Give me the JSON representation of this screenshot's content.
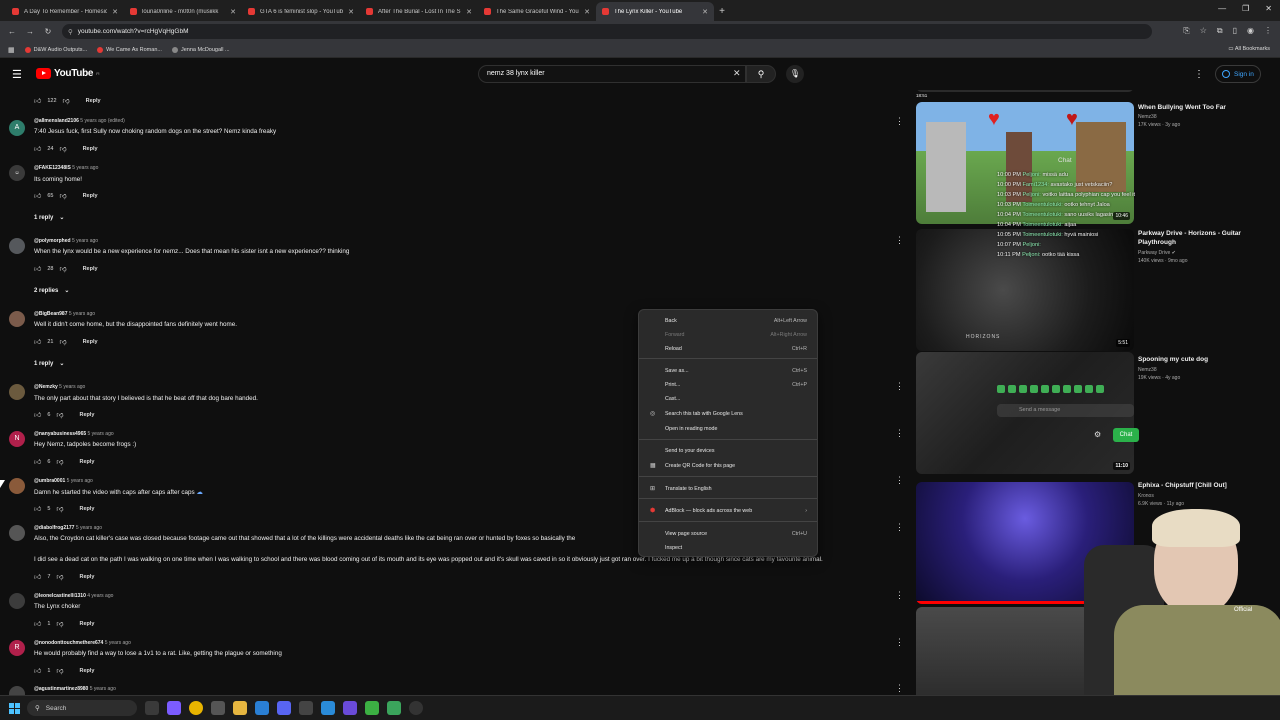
{
  "browser": {
    "tabs": [
      {
        "title": "A Day To Remember - Homesic",
        "active": false
      },
      {
        "title": "louna0nline - m0t0n (musiikk",
        "active": false
      },
      {
        "title": "GTA 6 is feminist slop - YouTub",
        "active": false
      },
      {
        "title": "After The Burial - Lost In The S",
        "active": false
      },
      {
        "title": "The Same Graceful Wind - You",
        "active": false
      },
      {
        "title": "The Lynx Killer - YouTube",
        "active": true
      }
    ],
    "url": "youtube.com/watch?v=rcHgVqHgGbM",
    "bookmarks": [
      "D&W Audio Outputs...",
      "We Came As Roman...",
      "Jenna McDougall ..."
    ],
    "all_bookmarks": "All Bookmarks"
  },
  "youtube": {
    "logo": "YouTube",
    "logo_suffix": "FI",
    "search_value": "nemz 38 lynx killer",
    "sign_in": "Sign in"
  },
  "comments": [
    {
      "likes": "122",
      "reply": "Reply"
    },
    {
      "handle": "@allmensland2106",
      "time": "5 years ago (edited)",
      "text": "7:40 Jesus fuck, first Sully now choking random dogs on the street? Nemz kinda freaky",
      "likes": "24",
      "reply": "Reply",
      "avatar": "A"
    },
    {
      "handle": "@FAKE12348IS",
      "time": "5 years ago",
      "text": "Its coming home!",
      "likes": "65",
      "reply": "Reply",
      "replies": "1 reply"
    },
    {
      "handle": "@polymorphed",
      "time": "5 years ago",
      "text": "When the lynx would be a new experience for nemz... Does that mean his sister isnt a new experience?? thinking",
      "likes": "28",
      "reply": "Reply",
      "replies": "2 replies"
    },
    {
      "handle": "@BigBean987",
      "time": "5 years ago",
      "text": "Well it didn't come home, but the disappointed fans definitely went home.",
      "likes": "21",
      "reply": "Reply",
      "replies": "1 reply"
    },
    {
      "handle": "@Nemzky",
      "time": "5 years ago",
      "text": "The only part about that story I believed is that he beat off that dog bare handed.",
      "likes": "6",
      "reply": "Reply"
    },
    {
      "handle": "@nanyabusiness4965",
      "time": "5 years ago",
      "text": "Hey Nemz, tadpoles become frogs :)",
      "likes": "6",
      "reply": "Reply",
      "avatar": "N"
    },
    {
      "handle": "@umbra0001",
      "time": "5 years ago",
      "text": "Damn he started the video with caps after caps after caps",
      "likes": "5",
      "reply": "Reply"
    },
    {
      "handle": "@diabolfrog2177",
      "time": "5 years ago",
      "text": "Also, the Croydon cat killer's case was closed because footage came out that showed that a lot of the killings were accidental deaths like the cat being ran over or hunted by foxes so basically the",
      "text2": "I did see a dead cat on the path I was walking on one time when I was walking to school and there was blood coming out of its mouth and its eye was popped out and it's skull was caved in so it obviously just got ran over. I fucked me up a bit though since cats are my favourite animal.",
      "likes": "7",
      "reply": "Reply"
    },
    {
      "handle": "@leonelcastinelli1310",
      "time": "4 years ago",
      "text": "The Lynx choker",
      "likes": "1",
      "reply": "Reply"
    },
    {
      "handle": "@nonodonttouchmethere674",
      "time": "5 years ago",
      "text": "He would probably find a way to lose a 1v1 to a rat. Like, getting the plague or something",
      "likes": "1",
      "reply": "Reply",
      "avatar": "R"
    },
    {
      "handle": "@agustinmartinez8980",
      "time": "5 years ago"
    }
  ],
  "sidebar": [
    {
      "title": "When Bullying Went Too Far",
      "channel": "Nemz38",
      "stats": "17K views · 3y ago",
      "duration": "10:46"
    },
    {
      "title": "Parkway Drive - Horizons - Guitar Playthrough",
      "channel": "Parkway Drive",
      "stats": "140K views · 9mo ago",
      "duration": "5:51"
    },
    {
      "title": "Spooning my cute dog",
      "channel": "Nemz38",
      "stats": "19K views · 4y ago",
      "duration": "11:10"
    },
    {
      "title": "Ephixa - Chipstuff [Chill Out]",
      "channel": "Kronos",
      "stats": "6.9K views · 11y ago"
    }
  ],
  "top_duration": "18:51",
  "stream_chat": {
    "header": "Chat",
    "lines": [
      {
        "time": "10:00 PM",
        "name": "Peljoni:",
        "msg": "missä adu"
      },
      {
        "time": "10:00 PM",
        "name": "Fami1234:",
        "msg": "avastako just vetskaciin?"
      },
      {
        "time": "10:03 PM",
        "name": "Peljoni:",
        "msg": "voitko laittaa polyphian cap you feel it"
      },
      {
        "time": "10:03 PM",
        "name": "Toimeentulotuki:",
        "msg": "ootko tehnyt Jaloa"
      },
      {
        "time": "10:04 PM",
        "name": "Toimeentulotuki:",
        "msg": "sano uusiks lagasin"
      },
      {
        "time": "10:04 PM",
        "name": "Toimeentulotuki:",
        "msg": "aijaa"
      },
      {
        "time": "10:05 PM",
        "name": "Toimeentulotuki:",
        "msg": "hyvä mainiosi"
      },
      {
        "time": "10:07 PM",
        "name": "Peljoni:",
        "msg": ""
      },
      {
        "time": "10:11 PM",
        "name": "Peljoni:",
        "msg": "ootko tää kissa"
      }
    ],
    "send_placeholder": "Send a message",
    "chat_button": "Chat"
  },
  "webcam_label": "Official",
  "context_menu": {
    "items": [
      {
        "label": "Back",
        "shortcut": "Alt+Left Arrow"
      },
      {
        "label": "Forward",
        "shortcut": "Alt+Right Arrow",
        "disabled": true
      },
      {
        "label": "Reload",
        "shortcut": "Ctrl+R"
      },
      {
        "label": "Save as...",
        "shortcut": "Ctrl+S"
      },
      {
        "label": "Print...",
        "shortcut": "Ctrl+P"
      },
      {
        "label": "Cast..."
      },
      {
        "label": "Search this tab with Google Lens",
        "icon": "lens-icon"
      },
      {
        "label": "Open in reading mode"
      },
      {
        "label": "Send to your devices"
      },
      {
        "label": "Create QR Code for this page",
        "icon": "qr-icon"
      },
      {
        "label": "Translate to English",
        "icon": "translate-icon"
      },
      {
        "label": "AdBlock — block ads across the web",
        "icon": "adblock-icon"
      },
      {
        "label": "View page source",
        "shortcut": "Ctrl+U"
      },
      {
        "label": "Inspect"
      }
    ]
  },
  "taskbar": {
    "search": "Search"
  }
}
